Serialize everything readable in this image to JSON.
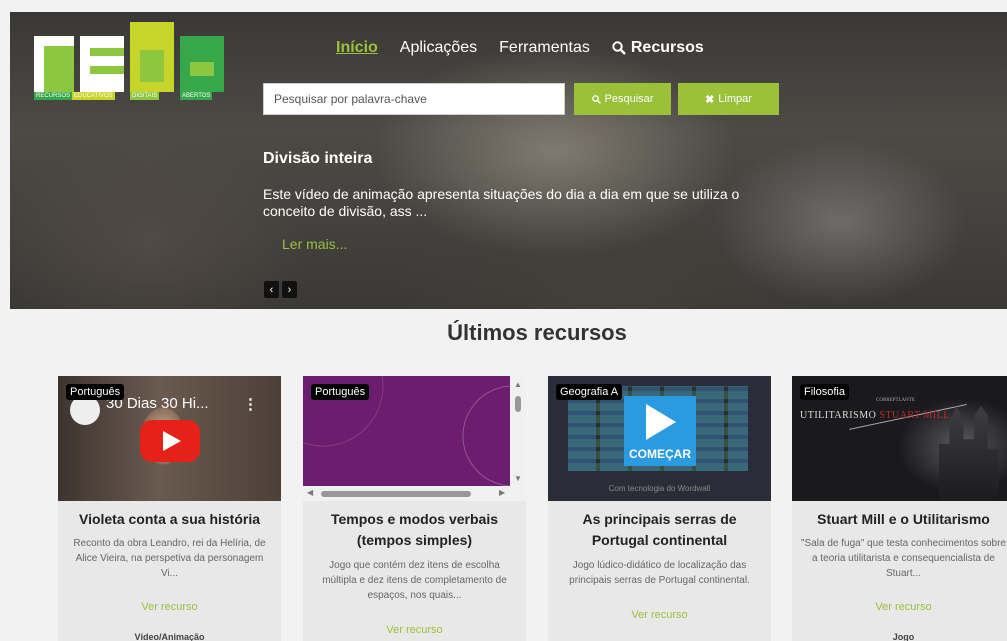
{
  "logo": {
    "words": [
      "RECURSOS",
      "EDUCATIVOS",
      "DIGITAIS",
      "ABERTOS"
    ],
    "colors": {
      "green": "#8dc63f",
      "lime": "#c7d42a",
      "white": "#ffffff",
      "teal": "#37a84a"
    }
  },
  "nav": {
    "items": [
      "Início",
      "Aplicações",
      "Ferramentas",
      "Recursos"
    ],
    "active": "Início"
  },
  "search": {
    "placeholder": "Pesquisar por palavra-chave",
    "search_label": "Pesquisar",
    "clear_label": "Limpar"
  },
  "slide": {
    "title": "Divisão inteira",
    "description": "Este vídeo de animação apresenta situações do dia a dia em que se utiliza o conceito de divisão, ass ...",
    "more": "Ler mais...",
    "prev": "‹",
    "next": "›"
  },
  "section_title": "Últimos recursos",
  "accent_color": "#9bc13b",
  "cards": [
    {
      "tag": "Português",
      "media_title": "30 Dias 30 Hi...",
      "title": "Violeta conta a sua história",
      "description": "Reconto da obra Leandro, rei da Helíria, de Alice Vieira, na perspetiva da personagem Vi...",
      "link": "Ver recurso",
      "type": "Vídeo/Animação"
    },
    {
      "tag": "Português",
      "title": "Tempos e modos verbais (tempos simples)",
      "description": "Jogo que contém dez itens de escolha múltipla e dez itens de completamento de espaços, nos quais...",
      "link": "Ver recurso",
      "type": ""
    },
    {
      "tag": "Geografia A",
      "media_button": "COMEÇAR",
      "media_footer": "Com tecnologia do Wordwall",
      "title": "As principais serras de Portugal continental",
      "description": "Jogo lúdico-didático de localização das principais serras de Portugal continental.",
      "link": "Ver recurso",
      "type": ""
    },
    {
      "tag": "Filosofia",
      "media_title_a": "UTILITARISMO",
      "media_title_b": "STUART MILL",
      "media_subtitle": "CORREPTLANTE",
      "title": "Stuart Mill e o Utilitarismo",
      "description": "\"Sala de fuga\" que testa conhecimentos sobre a teoria utilitarista e consequencialista de Stuart...",
      "link": "Ver recurso",
      "type": "Jogo"
    }
  ]
}
